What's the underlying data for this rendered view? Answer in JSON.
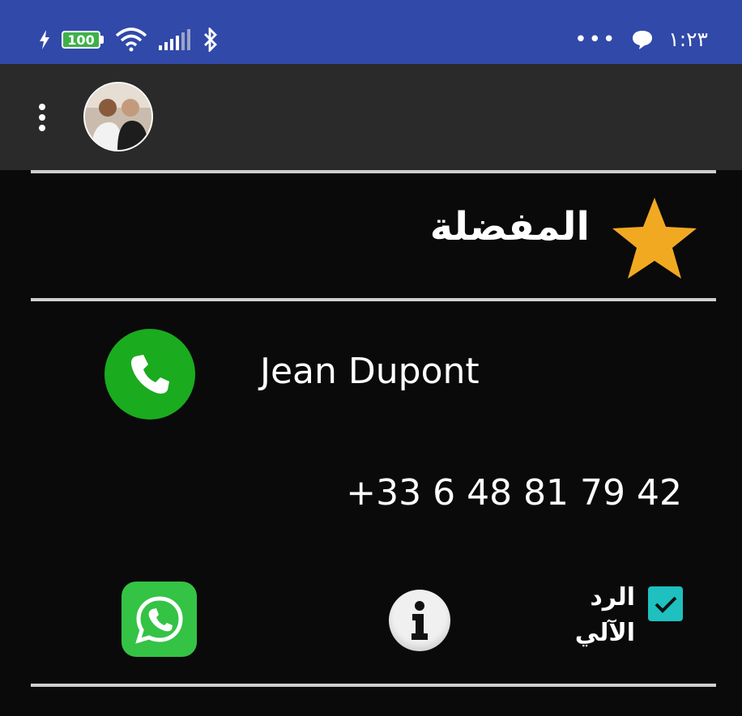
{
  "status_bar": {
    "battery_level": "100",
    "time": "١:٢٣",
    "overflow_dots": "•••",
    "icons": [
      "charging-icon",
      "battery-icon",
      "wifi-icon",
      "signal-icon",
      "bluetooth-icon",
      "chat-bubble-icon"
    ],
    "background_color": "#3149a8"
  },
  "toolbar": {
    "menu_icon": "kebab-menu-icon",
    "avatar": "contact-avatar",
    "background_color": "#2a2a2a"
  },
  "favorites": {
    "label": "المفضلة",
    "icon": "star-icon",
    "star_color": "#f2a922"
  },
  "contact": {
    "name": "Jean Dupont",
    "phone": "+33 6 48 81 79 42",
    "call_icon": "phone-icon",
    "call_color": "#1aab1f"
  },
  "actions": {
    "whatsapp_icon": "whatsapp-icon",
    "info_icon": "info-icon",
    "auto_reply": {
      "checked": true,
      "label_line1": "الرد",
      "label_line2": "الآلي",
      "check_color": "#1ec0c0"
    }
  }
}
